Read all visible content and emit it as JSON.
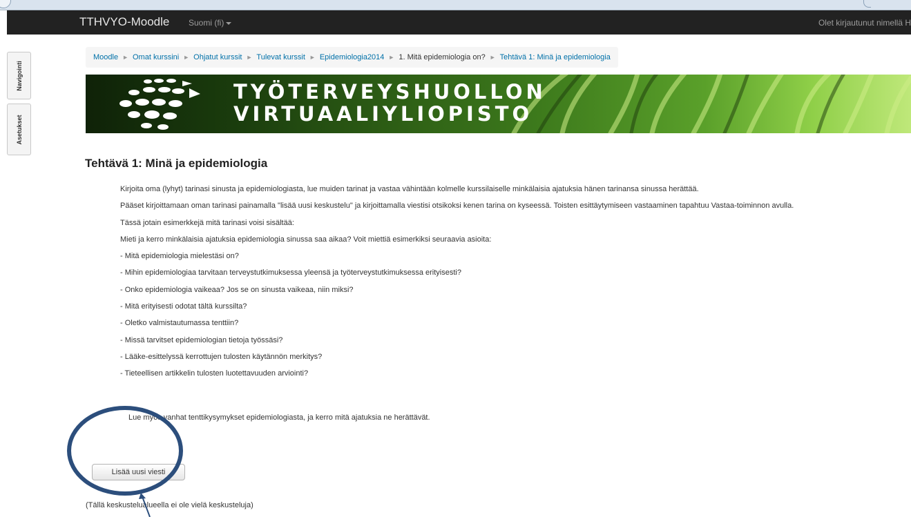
{
  "navbar": {
    "brand": "TTHVYO-Moodle",
    "language": "Suomi (fi)",
    "login_text": "Olet kirjautunut nimellä H"
  },
  "dock": {
    "navigation_label": "Navigointi",
    "settings_label": "Asetukset"
  },
  "breadcrumb": {
    "items": [
      "Moodle",
      "Omat kurssini",
      "Ohjatut kurssit",
      "Tulevat kurssit",
      "Epidemiologia2014",
      "1. Mitä epidemiologia on?",
      "Tehtävä 1: Minä ja epidemiologia"
    ]
  },
  "banner": {
    "line1": "TYÖTERVEYSHUOLLON",
    "line2": "VIRTUAALIYLIOPISTO"
  },
  "page": {
    "title": "Tehtävä 1: Minä ja epidemiologia",
    "paragraphs": [
      "Kirjoita oma (lyhyt) tarinasi sinusta ja epidemiologiasta, lue muiden tarinat ja vastaa vähintään kolmelle kurssilaiselle minkälaisia ajatuksia hänen tarinansa sinussa herättää.",
      "Pääset kirjoittamaan oman tarinasi painamalla \"lisää uusi keskustelu\" ja kirjoittamalla viestisi otsikoksi kenen tarina on kyseessä. Toisten esittäytymiseen vastaaminen tapahtuu Vastaa-toiminnon avulla.",
      "Tässä jotain esimerkkejä mitä tarinasi voisi sisältää:",
      "Mieti ja kerro minkälaisia ajatuksia epidemiologia sinussa saa aikaa? Voit miettiä esimerkiksi seuraavia asioita:",
      "- Mitä epidemiologia mielestäsi on?",
      "- Mihin epidemiologiaa tarvitaan terveystutkimuksessa yleensä ja työterveystutkimuksessa erityisesti?",
      "- Onko epidemiologia vaikeaa? Jos se on sinusta vaikeaa, niin miksi?",
      "- Mitä erityisesti odotat tältä kurssilta?",
      "- Oletko valmistautumassa tenttiin?",
      "- Missä tarvitset epidemiologian tietoja työssäsi?",
      "- Lääke-esittelyssä kerrottujen tulosten käytännön merkitys?",
      "- Tieteellisen artikkelin tulosten luotettavuuden arviointi?"
    ],
    "extra": "Lue myös vanhat tenttikysymykset epidemiologiasta, ja kerro mitä ajatuksia ne herättävät.",
    "add_button": "Lisää uusi viesti",
    "no_discussions": "(Tällä keskustelualueella ei ole vielä keskusteluja)"
  },
  "colors": {
    "navbar_bg": "#222222",
    "link": "#0070a8",
    "annotation": "#2c4e7c"
  }
}
